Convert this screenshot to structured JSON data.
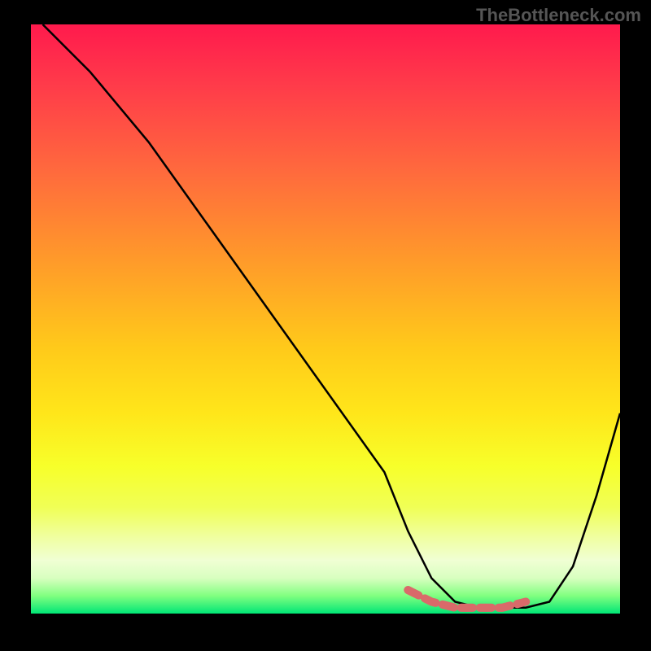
{
  "watermark": "TheBottleneck.com",
  "chart_data": {
    "type": "line",
    "title": "",
    "xlabel": "",
    "ylabel": "",
    "xlim": [
      0,
      100
    ],
    "ylim": [
      0,
      100
    ],
    "grid": false,
    "series": [
      {
        "name": "curve",
        "color": "#000000",
        "x": [
          2,
          6,
          10,
          20,
          30,
          40,
          50,
          60,
          64,
          68,
          72,
          76,
          80,
          84,
          88,
          92,
          96,
          100
        ],
        "values": [
          100,
          96,
          92,
          80,
          66,
          52,
          38,
          24,
          14,
          6,
          2,
          1,
          1,
          1,
          2,
          8,
          20,
          34
        ]
      },
      {
        "name": "highlight-flat",
        "color": "#d96a6a",
        "x": [
          64,
          68,
          72,
          76,
          80,
          84
        ],
        "values": [
          4,
          2,
          1,
          1,
          1,
          2
        ]
      }
    ],
    "background_gradient": {
      "top": "#ff1a4d",
      "bottom": "#00e676"
    }
  }
}
